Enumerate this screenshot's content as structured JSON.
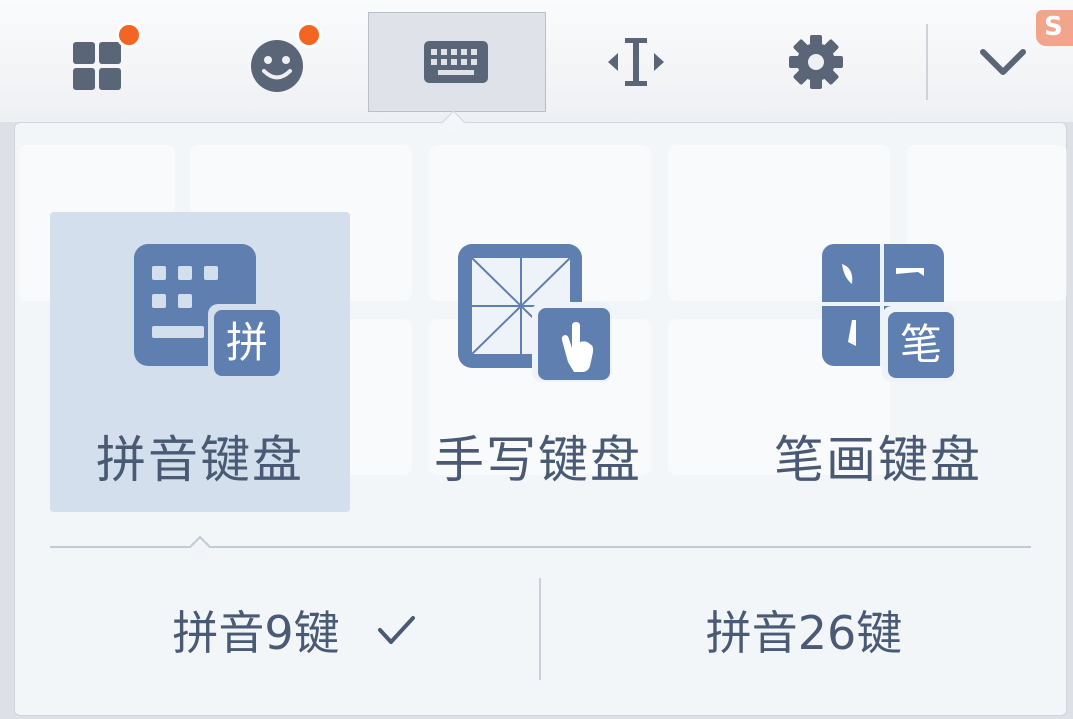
{
  "toolbar": {
    "items": [
      {
        "name": "apps",
        "icon": "apps-grid-icon",
        "badge": true
      },
      {
        "name": "emoji",
        "icon": "smiley-icon",
        "badge": true
      },
      {
        "name": "keyboard",
        "icon": "keyboard-icon",
        "active": true
      },
      {
        "name": "cursor",
        "icon": "cursor-move-icon"
      },
      {
        "name": "settings",
        "icon": "gear-icon"
      },
      {
        "name": "collapse",
        "icon": "chevron-down-icon"
      }
    ],
    "brand_text": "S"
  },
  "keyboard_types": [
    {
      "label": "拼音键盘",
      "icon": "pinyin-keyboard-icon",
      "selected": true,
      "badge_char": "拼"
    },
    {
      "label": "手写键盘",
      "icon": "handwriting-keyboard-icon",
      "selected": false
    },
    {
      "label": "笔画键盘",
      "icon": "stroke-keyboard-icon",
      "selected": false,
      "badge_char": "笔"
    }
  ],
  "layouts": [
    {
      "label": "拼音9键",
      "selected": true
    },
    {
      "label": "拼音26键",
      "selected": false
    }
  ],
  "colors": {
    "accent": "#5f7fb0",
    "text": "#4a5a74",
    "selected_bg": "#d3dfec",
    "badge": "#f26522"
  }
}
